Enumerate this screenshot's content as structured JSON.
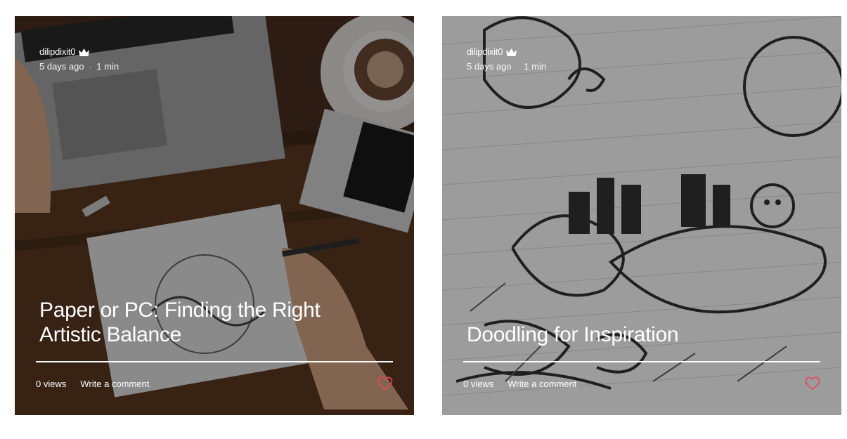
{
  "posts": [
    {
      "author": "dilipdixit0",
      "author_badge_icon": "crown-icon",
      "date": "5 days ago",
      "separator": "·",
      "read_time": "1 min",
      "title": "Paper or PC: Finding the Right Artistic Balance",
      "views": "0 views",
      "comment_label": "Write a comment",
      "like_icon": "heart-outline-icon"
    },
    {
      "author": "dilipdixit0",
      "author_badge_icon": "crown-icon",
      "date": "5 days ago",
      "separator": "·",
      "read_time": "1 min",
      "title": "Doodling for Inspiration",
      "views": "0 views",
      "comment_label": "Write a comment",
      "like_icon": "heart-outline-icon"
    }
  ],
  "colors": {
    "like_heart": "#e8475e",
    "text": "#ffffff"
  }
}
